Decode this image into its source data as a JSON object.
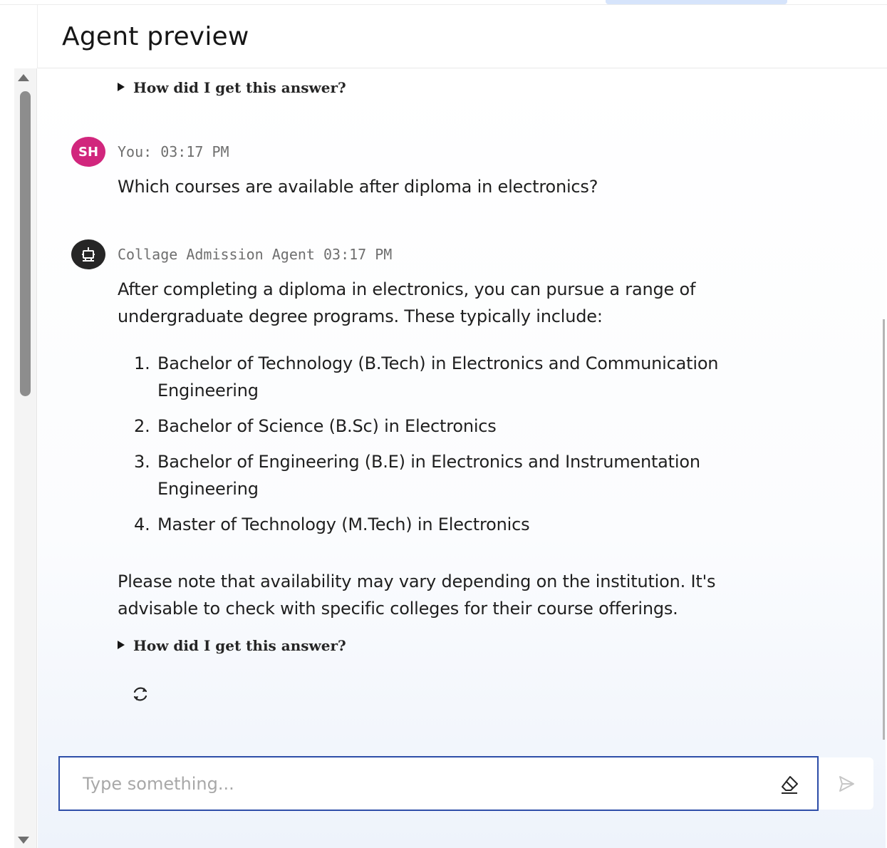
{
  "header": {
    "title": "Agent preview"
  },
  "conversation": {
    "previous_answer_disclosure": "How did I get this answer?",
    "user_message": {
      "avatar_initials": "SH",
      "avatar_color": "#d1267d",
      "meta": "You: 03:17 PM",
      "text": "Which courses are available after diploma in electronics?"
    },
    "agent_message": {
      "avatar_icon": "robot-icon",
      "meta": "Collage Admission Agent 03:17 PM",
      "intro_line1": "After completing a diploma in electronics, you can pursue a range of",
      "intro_line2": "undergraduate degree programs. These typically include:",
      "courses": [
        {
          "num": "1.",
          "line1": "Bachelor of Technology (B.Tech) in Electronics and Communication",
          "line2": "Engineering"
        },
        {
          "num": "2.",
          "line1": "Bachelor of Science (B.Sc) in Electronics",
          "line2": ""
        },
        {
          "num": "3.",
          "line1": "Bachelor of Engineering (B.E) in Electronics and Instrumentation",
          "line2": "Engineering"
        },
        {
          "num": "4.",
          "line1": "Master of Technology (M.Tech) in Electronics",
          "line2": ""
        }
      ],
      "note_line1": "Please note that availability may vary depending on the institution. It's",
      "note_line2": "advisable to check with specific colleges for their course offerings.",
      "disclosure": "How did I get this answer?",
      "regenerate_icon": "refresh-icon"
    }
  },
  "composer": {
    "placeholder": "Type something...",
    "clear_icon": "eraser-icon",
    "send_icon": "send-icon",
    "accent_color": "#2e4ea8"
  }
}
